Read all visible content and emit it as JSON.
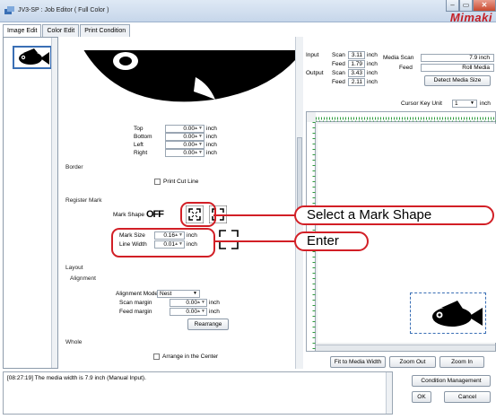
{
  "window": {
    "title": "JV3-SP : Job Editor ( Full Color )",
    "logo": "Mimaki",
    "min": "–",
    "max": "▭",
    "close": "✕"
  },
  "tabs": [
    "Image Edit",
    "Color Edit",
    "Print Condition"
  ],
  "margins": {
    "top": {
      "label": "Top",
      "value": "0.00",
      "unit": "inch"
    },
    "bottom": {
      "label": "Bottom",
      "value": "0.00",
      "unit": "inch"
    },
    "left": {
      "label": "Left",
      "value": "0.00",
      "unit": "inch"
    },
    "right": {
      "label": "Right",
      "value": "0.00",
      "unit": "inch"
    }
  },
  "border": {
    "section": "Border",
    "print_cut_line": "Print Cut Line"
  },
  "register_mark": {
    "section": "Register Mark",
    "mark_shape_label": "Mark Shape",
    "off_label": "OFF",
    "mark_size": {
      "label": "Mark Size",
      "value": "0.16",
      "unit": "inch"
    },
    "line_width": {
      "label": "Line Width",
      "value": "0.01",
      "unit": "inch"
    }
  },
  "layout": {
    "section": "Layout",
    "alignment": "Alignment",
    "alignment_mode_label": "Alignment Mode",
    "alignment_mode_value": "Nest",
    "scan_margin": {
      "label": "Scan margin",
      "value": "0.00",
      "unit": "inch"
    },
    "feed_margin": {
      "label": "Feed margin",
      "value": "0.00",
      "unit": "inch"
    },
    "rearrange": "Rearrange"
  },
  "whole": {
    "section": "Whole",
    "arrange_center": "Arrange in the Center"
  },
  "info": {
    "input_label": "Input",
    "input_scan_label": "Scan",
    "input_scan": "3.11",
    "input_scan_unit": "inch",
    "input_feed_label": "Feed",
    "input_feed": "1.79",
    "input_feed_unit": "inch",
    "output_label": "Output",
    "output_scan_label": "Scan",
    "output_scan": "3.43",
    "output_scan_unit": "inch",
    "output_feed_label": "Feed",
    "output_feed": "2.11",
    "output_feed_unit": "inch",
    "media_scan_label": "Media Scan",
    "media_scan": "7.9 inch",
    "media_feed_label": "Feed",
    "media_feed": "Roll Media",
    "detect_media_size": "Detect Media Size",
    "cursor_key_unit_label": "Cursor Key Unit",
    "cursor_key_unit_value": "1",
    "cursor_key_unit_suffix": "inch"
  },
  "canvas_buttons": {
    "fit": "Fit to Media Width",
    "zoom_out": "Zoom Out",
    "zoom_in": "Zoom In"
  },
  "status": {
    "message": "[08:27:19] The media width is 7.9 inch (Manual Input)."
  },
  "bottom_buttons": {
    "condition_management": "Condition Management",
    "ok": "OK",
    "cancel": "Cancel"
  },
  "callouts": {
    "select_shape": "Select a Mark Shape",
    "enter": "Enter"
  },
  "colors": {
    "accent_red": "#d21f26",
    "selection_blue": "#3a6fb5"
  }
}
